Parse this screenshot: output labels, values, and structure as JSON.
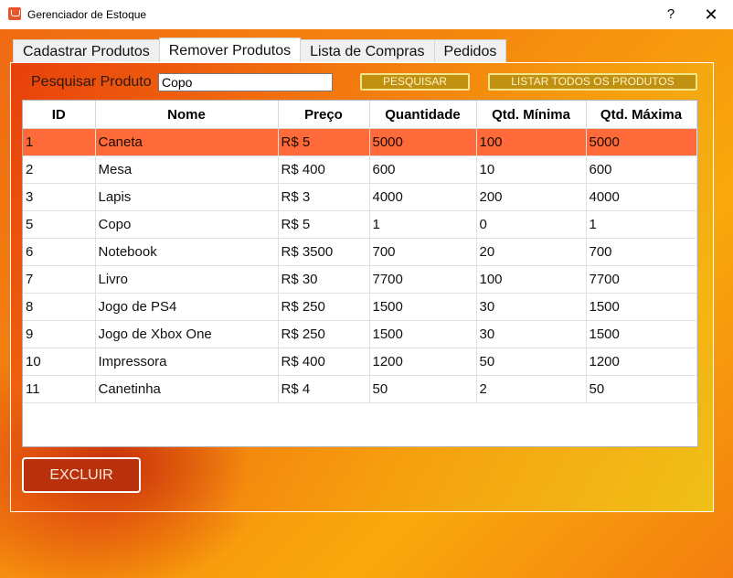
{
  "window": {
    "title": "Gerenciador de Estoque",
    "help_label": "?",
    "close_label": "✕"
  },
  "tabs": [
    {
      "label": "Cadastrar Produtos",
      "active": false
    },
    {
      "label": "Remover Produtos",
      "active": true
    },
    {
      "label": "Lista de Compras",
      "active": false
    },
    {
      "label": "Pedidos",
      "active": false
    }
  ],
  "search": {
    "label": "Pesquisar Produto",
    "value": "Copo",
    "search_button": "PESQUISAR",
    "list_all_button": "LISTAR TODOS OS PRODUTOS"
  },
  "table": {
    "columns": [
      "ID",
      "Nome",
      "Preço",
      "Quantidade",
      "Qtd. Mínima",
      "Qtd. Máxima"
    ],
    "selected_row": 0,
    "rows": [
      [
        "1",
        "Caneta",
        "R$ 5",
        "5000",
        "100",
        "5000"
      ],
      [
        "2",
        "Mesa",
        "R$ 400",
        "600",
        "10",
        "600"
      ],
      [
        "3",
        "Lapis",
        "R$ 3",
        "4000",
        "200",
        "4000"
      ],
      [
        "5",
        "Copo",
        "R$ 5",
        "1",
        "0",
        "1"
      ],
      [
        "6",
        "Notebook",
        "R$ 3500",
        "700",
        "20",
        "700"
      ],
      [
        "7",
        "Livro",
        "R$ 30",
        "7700",
        "100",
        "7700"
      ],
      [
        "8",
        "Jogo de PS4",
        "R$ 250",
        "1500",
        "30",
        "1500"
      ],
      [
        "9",
        "Jogo de Xbox One",
        "R$ 250",
        "1500",
        "30",
        "1500"
      ],
      [
        "10",
        "Impressora",
        "R$ 400",
        "1200",
        "50",
        "1200"
      ],
      [
        "11",
        "Canetinha",
        "R$ 4",
        "50",
        "2",
        "50"
      ]
    ]
  },
  "actions": {
    "delete_button": "EXCLUIR"
  },
  "colors": {
    "selected_row": "#ff6a3a",
    "gold_button": "#c09010",
    "delete_button": "#b8300c"
  }
}
